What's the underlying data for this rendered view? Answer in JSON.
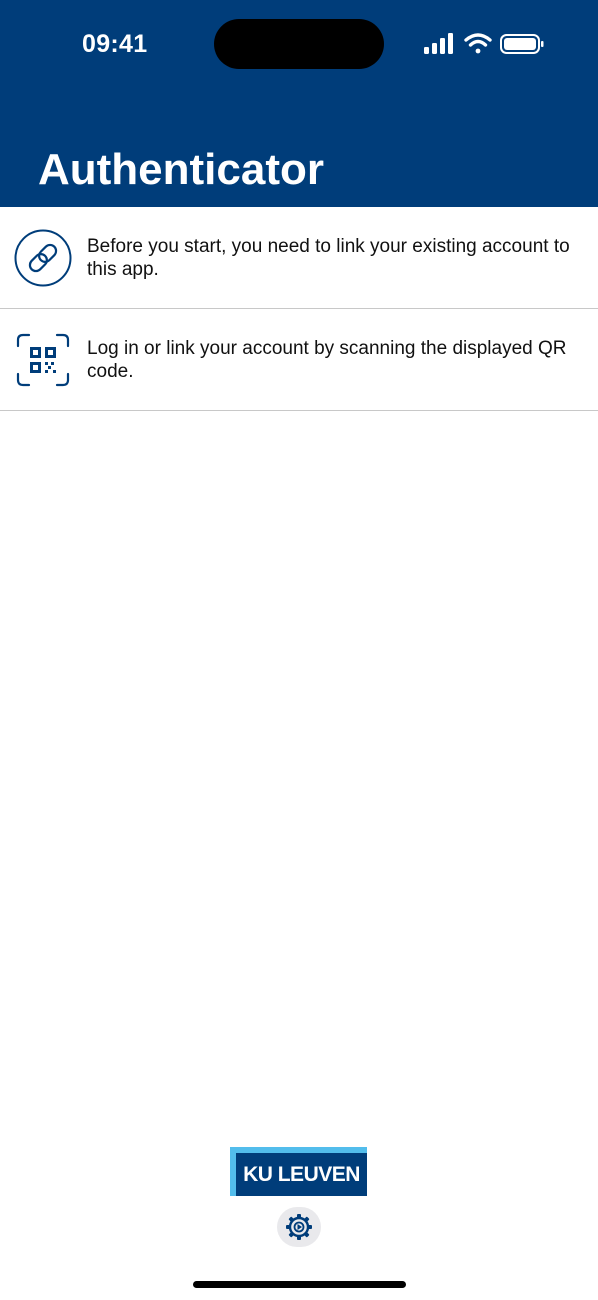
{
  "status_bar": {
    "time": "09:41",
    "icons": [
      "signal-icon",
      "wifi-icon",
      "battery-icon"
    ]
  },
  "header": {
    "title": "Authenticator",
    "background_color": "#003D7A"
  },
  "list": {
    "items": [
      {
        "icon": "link-icon",
        "text": "Before you start, you need to link your existing account to this app."
      },
      {
        "icon": "qr-scan-icon",
        "text": "Log in or link your account by scanning the displayed QR code."
      }
    ]
  },
  "footer": {
    "logo_text": "KU LEUVEN",
    "logo_color": "#003D7A",
    "logo_accent_color": "#52BDEC",
    "settings_icon": "gear-icon"
  }
}
